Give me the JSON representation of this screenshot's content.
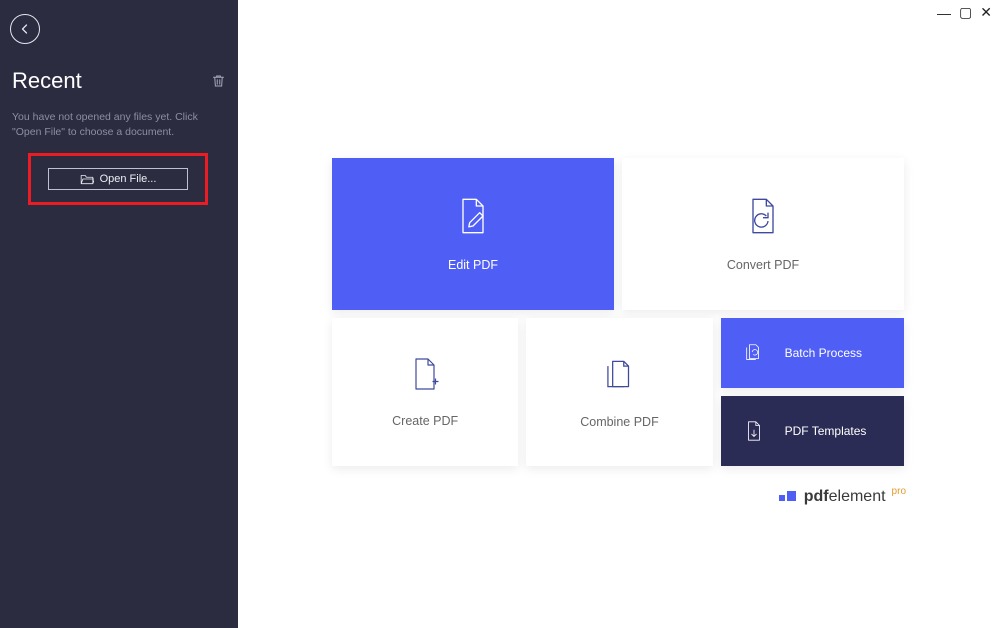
{
  "window": {
    "minimize": "—",
    "maximize": "▢",
    "close": "✕"
  },
  "sidebar": {
    "title": "Recent",
    "hint": "You have not opened any files yet. Click \"Open File\" to choose a document.",
    "open_file_label": "Open File..."
  },
  "cards": {
    "edit": "Edit PDF",
    "convert": "Convert PDF",
    "create": "Create PDF",
    "combine": "Combine PDF",
    "batch": "Batch Process",
    "templates": "PDF Templates"
  },
  "brand": {
    "part1": "pdf",
    "part2": "element",
    "pro": "pro"
  }
}
